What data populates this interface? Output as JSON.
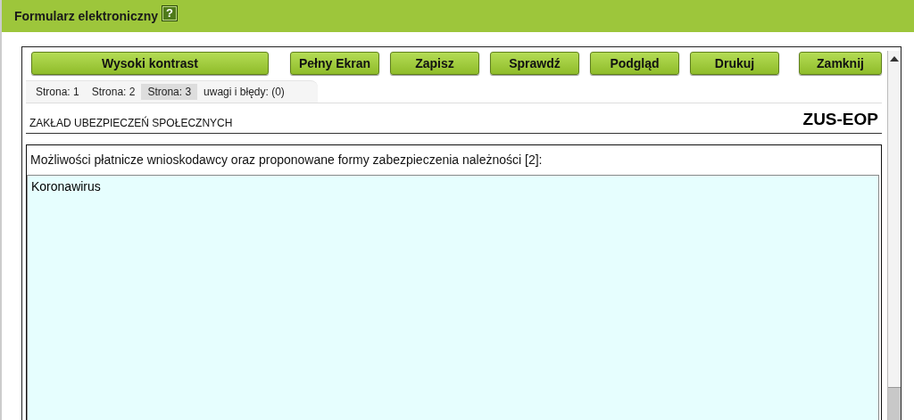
{
  "window": {
    "title": "Formularz elektroniczny",
    "help": "?"
  },
  "toolbar": {
    "buttons": [
      {
        "label": "Wysoki kontrast",
        "kind": "wide"
      },
      {
        "label": "Pełny Ekran",
        "kind": "normal"
      },
      {
        "label": "Zapisz",
        "kind": "normal"
      },
      {
        "label": "Sprawdź",
        "kind": "normal"
      },
      {
        "label": "Podgląd",
        "kind": "normal"
      },
      {
        "label": "Drukuj",
        "kind": "normal"
      },
      {
        "label": "Zamknij",
        "kind": "normal"
      }
    ]
  },
  "tabs": [
    {
      "label": "Strona: 1",
      "selected": false
    },
    {
      "label": "Strona: 2",
      "selected": false
    },
    {
      "label": "Strona: 3",
      "selected": true
    },
    {
      "label": "uwagi i błędy: (0)",
      "selected": false
    }
  ],
  "form": {
    "institution": "ZAKŁAD  UBEZPIECZEŃ  SPOŁECZNYCH",
    "code": "ZUS-EOP",
    "field": {
      "label": "Możliwości płatnicze wnioskodawcy oraz proponowane formy zabezpieczenia należności [2]:",
      "value": "Koronawirus"
    }
  }
}
